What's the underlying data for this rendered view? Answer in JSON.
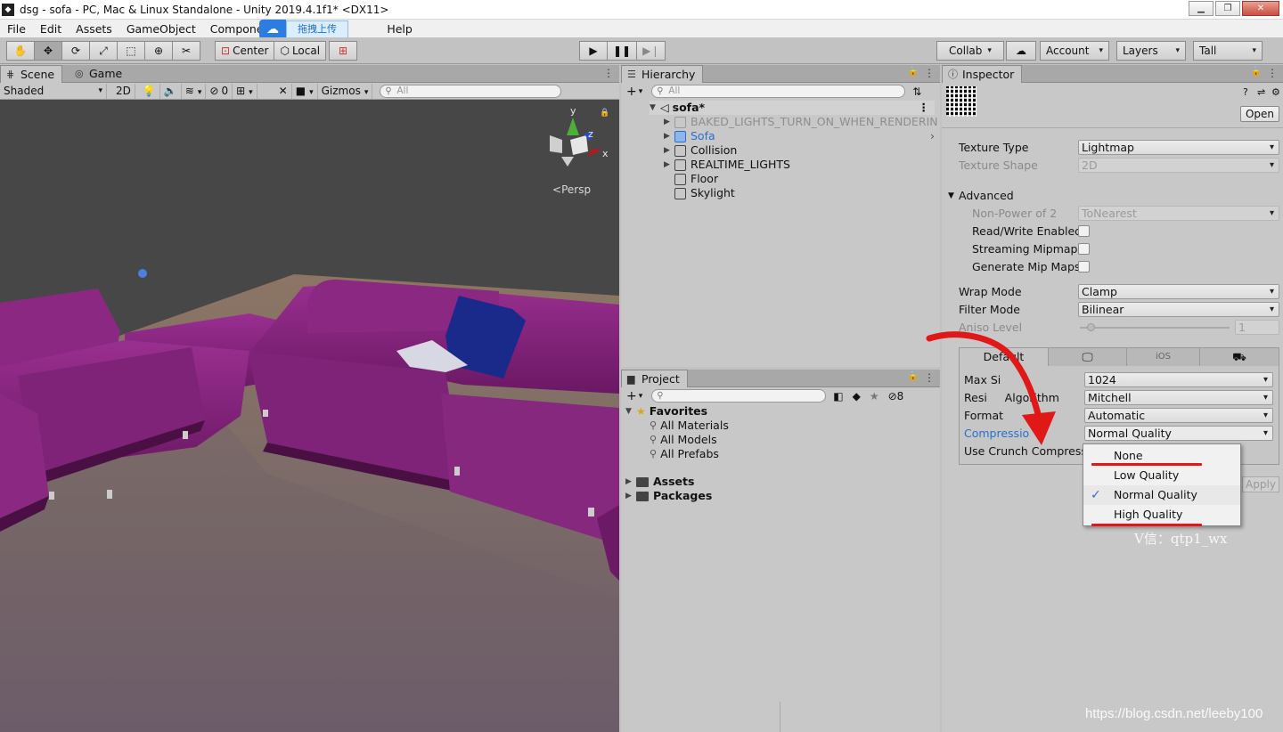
{
  "window": {
    "title": "dsg - sofa - PC, Mac & Linux Standalone - Unity 2019.4.1f1* <DX11>"
  },
  "menu": [
    "File",
    "Edit",
    "Assets",
    "GameObject",
    "Component",
    "Help"
  ],
  "baidu": {
    "upload_label": "拖拽上传"
  },
  "toolbar": {
    "pivot": "Center",
    "space": "Local",
    "collab": "Collab",
    "account": "Account",
    "layers": "Layers",
    "layout": "Tall"
  },
  "scene": {
    "tab_scene": "Scene",
    "tab_game": "Game",
    "shading": "Shaded",
    "mode2d": "2D",
    "hidden_count": "0",
    "gizmos": "Gizmos",
    "search_placeholder": "All",
    "gizmo_y": "y",
    "gizmo_z": "z",
    "gizmo_x": "x",
    "persp": "Persp"
  },
  "hierarchy": {
    "tab": "Hierarchy",
    "search_placeholder": "All",
    "root": "sofa*",
    "items": [
      {
        "label": "BAKED_LIGHTS_TURN_ON_WHEN_RENDERIN"
      },
      {
        "label": "Sofa"
      },
      {
        "label": "Collision"
      },
      {
        "label": "REALTIME_LIGHTS"
      },
      {
        "label": "Floor"
      },
      {
        "label": "Skylight"
      }
    ]
  },
  "project": {
    "tab": "Project",
    "hidden_count": "8",
    "favorites": "Favorites",
    "fav_items": [
      "All Materials",
      "All Models",
      "All Prefabs"
    ],
    "assets": "Assets",
    "packages": "Packages"
  },
  "inspector": {
    "tab": "Inspector",
    "open": "Open",
    "texture_type": {
      "label": "Texture Type",
      "value": "Lightmap"
    },
    "texture_shape": {
      "label": "Texture Shape",
      "value": "2D"
    },
    "advanced": "Advanced",
    "npot": {
      "label": "Non-Power of 2",
      "value": "ToNearest"
    },
    "read_write": "Read/Write Enabled",
    "streaming": "Streaming Mipmaps",
    "gen_mip": "Generate Mip Maps",
    "wrap": {
      "label": "Wrap Mode",
      "value": "Clamp"
    },
    "filter": {
      "label": "Filter Mode",
      "value": "Bilinear"
    },
    "aniso": {
      "label": "Aniso Level",
      "value": "1"
    },
    "platform": {
      "default_tab": "Default",
      "ios_tab": "iOS",
      "max_size": {
        "label": "Max Si",
        "value": "1024"
      },
      "resize": {
        "label": "Resi     Algorithm",
        "value": "Mitchell"
      },
      "format": {
        "label": "Format",
        "value": "Automatic"
      },
      "compression": {
        "label": "Compressio",
        "value": "Normal Quality"
      },
      "crunch": {
        "label": "Use Crunch Compressio"
      }
    },
    "apply": "Apply"
  },
  "compression_popup": {
    "options": [
      "None",
      "Low Quality",
      "Normal Quality",
      "High Quality"
    ],
    "selected": "Normal Quality",
    "check": "✓"
  },
  "watermarks": {
    "wechat": "V信：qtp1_wx",
    "blog": "https://blog.csdn.net/leeby100"
  },
  "colors": {
    "selection_blue": "#2a6fce",
    "annotation_red": "#e01818",
    "sofa_purple": "#7a1e74"
  }
}
